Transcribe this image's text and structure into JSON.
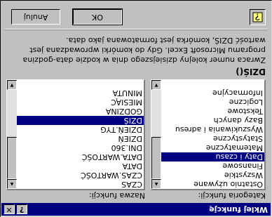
{
  "window": {
    "title": "Wklej funkcję",
    "help_glyph": "?",
    "close_glyph": "✕"
  },
  "category": {
    "label": "Kategoria funkcji:",
    "items": [
      "Ostatnio używane",
      "Wszystkie",
      "Finansowe",
      "Daty i czasu",
      "Matematyczne",
      "Statystyczne",
      "Wyszukiwania i adresu",
      "Bazy danych",
      "Tekstowe",
      "Logiczne",
      "Informacyjne"
    ],
    "selected_index": 3
  },
  "functions": {
    "label": "Nazwa funkcji:",
    "items": [
      "CZAS",
      "CZAS.WARTOŚĆ",
      "DATA",
      "DATA.WARTOŚĆ",
      "DNI.360",
      "DZIEŃ",
      "DZIEŃ.TYG",
      "DZIŚ",
      "GODZINA",
      "MIESIĄC",
      "MINUTA"
    ],
    "selected_index": 7
  },
  "selected_function": {
    "name": "DZIŚ()",
    "description": "Zwraca numer kolejny dzisiejszego dnia w kodzie data-godzina programu Microsoft Excel. Gdy do komórki wprowadzana jest wartość DZIŚ, komórka jest formatowana jako data."
  },
  "buttons": {
    "ok": "OK",
    "cancel": "Anuluj"
  }
}
